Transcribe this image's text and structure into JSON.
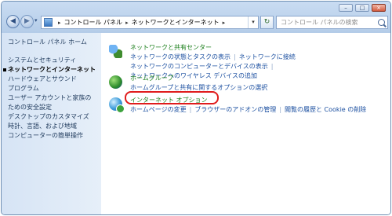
{
  "window": {
    "controls": [
      "–",
      "□",
      "×"
    ]
  },
  "address_bar": {
    "breadcrumbs": [
      "コントロール パネル",
      "ネットワークとインターネット"
    ],
    "refresh_icon": "refresh-icon"
  },
  "search": {
    "placeholder": "コントロール パネルの検索"
  },
  "sidebar": {
    "home": "コントロール パネル ホーム",
    "items": [
      {
        "label": "システムとセキュリティ"
      },
      {
        "label": "ネットワークとインターネット",
        "current": true
      },
      {
        "label": "ハードウェアとサウンド"
      },
      {
        "label": "プログラム"
      },
      {
        "label": "ユーザー アカウントと家族のための安全設定"
      },
      {
        "label": "デスクトップのカスタマイズ"
      },
      {
        "label": "時計、言語、および地域"
      },
      {
        "label": "コンピューターの簡単操作"
      }
    ]
  },
  "categories": [
    {
      "title": "ネットワークと共有センター",
      "icon": "network-sharing-icon",
      "links": [
        [
          "ネットワークの状態とタスクの表示",
          "ネットワークに接続"
        ],
        [
          "ネットワークのコンピューターとデバイスの表示",
          "ネットワークへのワイヤレス デバイスの追加"
        ]
      ]
    },
    {
      "title": "ホームグループ",
      "icon": "homegroup-icon",
      "links": [
        [
          "ホームグループと共有に関するオプションの選択"
        ]
      ]
    },
    {
      "title": "インターネット オプション",
      "icon": "internet-options-icon",
      "highlighted": true,
      "highlight_color": "#e01c1c",
      "links": [
        [
          "ホームページの変更",
          "ブラウザーのアドオンの管理",
          "閲覧の履歴と Cookie の削除"
        ]
      ]
    }
  ]
}
